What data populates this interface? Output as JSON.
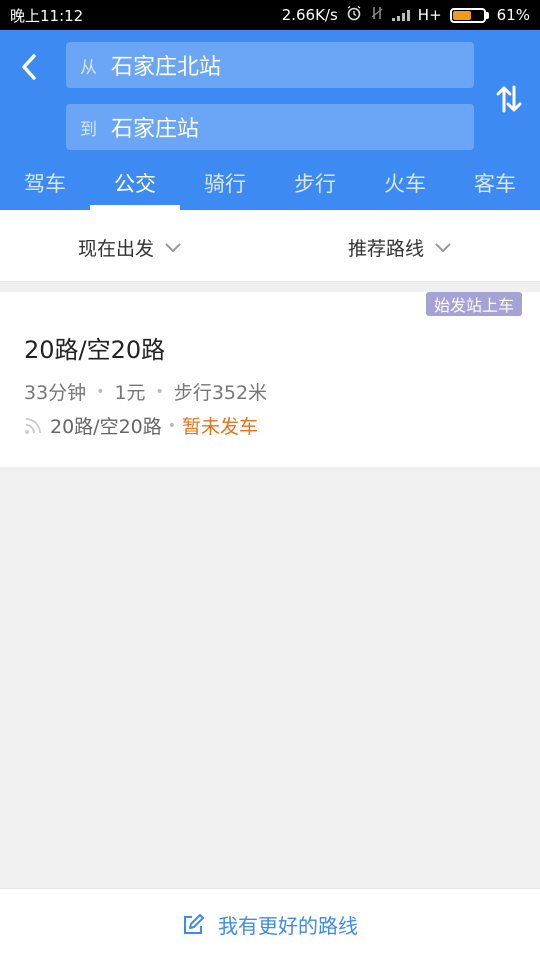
{
  "status_bar": {
    "time": "晚上11:12",
    "network_speed": "2.66K/s",
    "network_type": "H+",
    "battery": "61%",
    "battery_level": 0.61,
    "icons": [
      "alarm-icon",
      "no-sim-icon",
      "signal-icon",
      "battery-icon"
    ]
  },
  "header": {
    "from_prefix": "从",
    "from_value": "石家庄北站",
    "to_prefix": "到",
    "to_value": "石家庄站",
    "tabs": [
      {
        "label": "驾车",
        "active": false
      },
      {
        "label": "公交",
        "active": true
      },
      {
        "label": "骑行",
        "active": false
      },
      {
        "label": "步行",
        "active": false
      },
      {
        "label": "火车",
        "active": false
      },
      {
        "label": "客车",
        "active": false
      }
    ]
  },
  "filters": {
    "departure": "现在出发",
    "strategy": "推荐路线"
  },
  "route": {
    "badge": "始发站上车",
    "title": "20路/空20路",
    "duration": "33分钟",
    "price": "1元",
    "walk": "步行352米",
    "realtime_line": "20路/空20路",
    "realtime_status": "暂未发车"
  },
  "bottom": {
    "label": "我有更好的路线"
  },
  "colors": {
    "primary": "#3d8bf2",
    "field_bg": "#6aa6f5",
    "badge": "#a7a2d6",
    "status_orange": "#e8711a"
  }
}
